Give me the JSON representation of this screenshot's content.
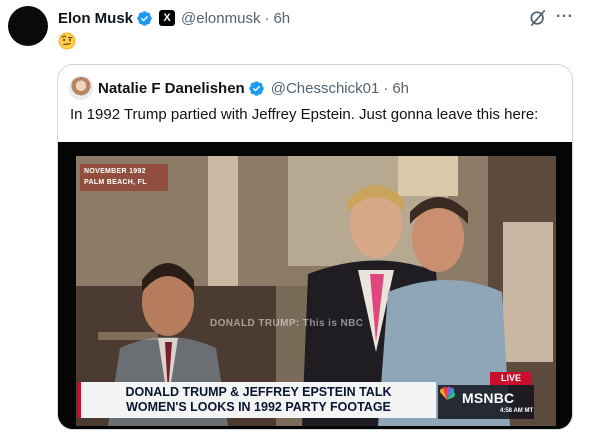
{
  "post": {
    "author_name": "Elon Musk",
    "author_handle": "@elonmusk",
    "separator": "·",
    "time": "6h",
    "affiliation_badge": "X",
    "reaction_emoji": "face-with-raised-eyebrow",
    "icons": [
      "grok-icon",
      "more-icon",
      "verified-badge-icon"
    ]
  },
  "quoted": {
    "author_name": "Natalie F Danelishen",
    "author_handle": "@Chesschick01",
    "separator": "·",
    "time": "6h",
    "text": "In 1992 Trump partied with Jeffrey Epstein. Just gonna leave this here:"
  },
  "video": {
    "location_tag_line1": "NOVEMBER 1992",
    "location_tag_line2": "PALM BEACH, FL",
    "watermark": "DONALD TRUMP: This is NBC",
    "live_label": "LIVE",
    "chyron_line1": "DONALD TRUMP & JEFFREY EPSTEIN TALK",
    "chyron_line2": "WOMEN'S LOOKS IN 1992 PARTY FOOTAGE",
    "network": "MSNBC",
    "clock": "4:58 AM MT",
    "colors": {
      "live_red": "#c8102e",
      "chyron_bg": "#f4f4f4",
      "chyron_text": "#0a1630"
    }
  },
  "colors": {
    "verified_blue": "#1d9bf0",
    "secondary_text": "#536471",
    "border": "#cfd9de"
  }
}
